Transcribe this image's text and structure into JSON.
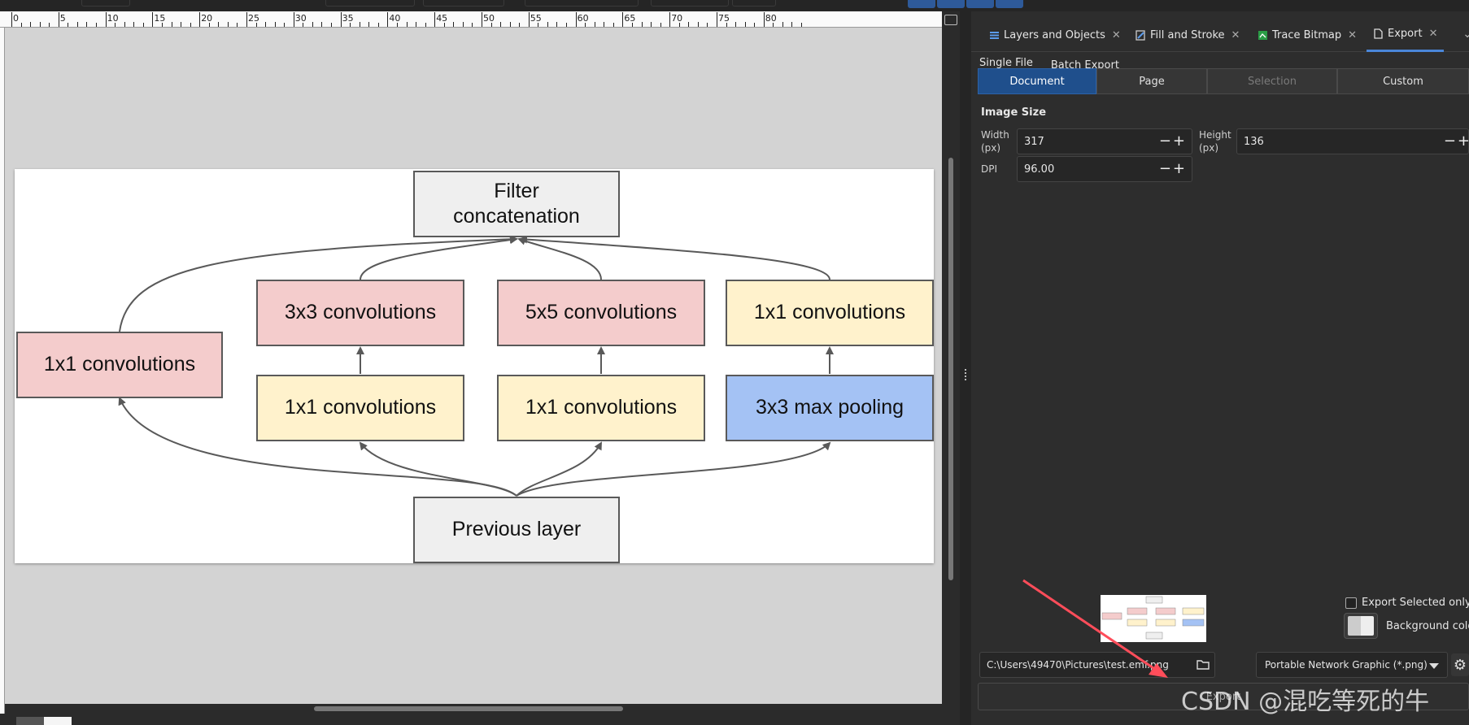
{
  "ruler": {
    "labels": [
      "0",
      "5",
      "10",
      "15",
      "20",
      "25",
      "30",
      "35",
      "40",
      "45",
      "50",
      "55",
      "60",
      "65",
      "70",
      "75",
      "80"
    ]
  },
  "diagram": {
    "top_box": "Filter\nconcatenation",
    "left_box": "1x1 convolutions",
    "row1": [
      "3x3 convolutions",
      "5x5 convolutions",
      "1x1 convolutions"
    ],
    "row2": [
      "1x1 convolutions",
      "1x1 convolutions",
      "3x3 max pooling"
    ],
    "bottom_box": "Previous layer",
    "colors": {
      "pink": "#f4cccc",
      "yellow": "#fff2cc",
      "blue": "#a4c2f4",
      "gray": "#efefef",
      "border": "#595959"
    }
  },
  "panel": {
    "tabs": [
      {
        "label": "Layers and Objects",
        "icon": "layers-icon"
      },
      {
        "label": "Fill and Stroke",
        "icon": "fill-stroke-icon"
      },
      {
        "label": "Trace Bitmap",
        "icon": "trace-bitmap-icon"
      },
      {
        "label": "Export",
        "icon": "export-icon",
        "active": true
      }
    ],
    "subtabs": [
      "Single File",
      "Batch Export"
    ],
    "segments": [
      "Document",
      "Page",
      "Selection",
      "Custom"
    ],
    "image_size_heading": "Image Size",
    "width_label": "Width\n(px)",
    "width_value": "317",
    "height_label": "Height\n(px)",
    "height_value": "136",
    "dpi_label": "DPI",
    "dpi_value": "96.00",
    "plusminus": "−+",
    "export_selected_only": "Export Selected only",
    "background_color": "Background colo",
    "path": "C:\\Users\\49470\\Pictures\\test.emf.png",
    "format": "Portable Network Graphic (*.png)",
    "export_button": "Export",
    "accent": "#4a86d8"
  },
  "watermark": "CSDN @混吃等死的牛"
}
